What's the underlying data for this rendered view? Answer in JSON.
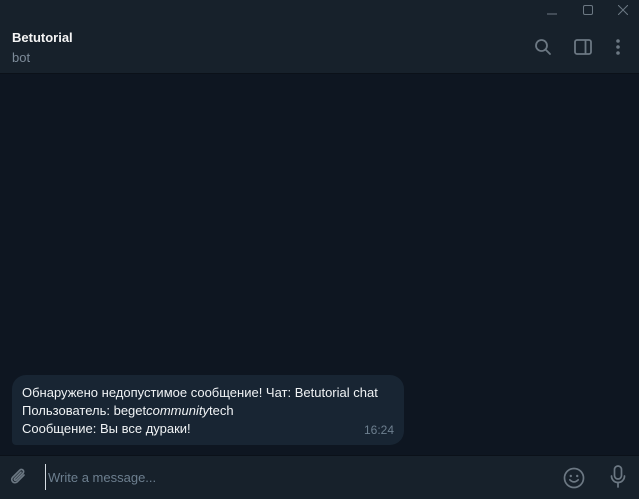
{
  "chat": {
    "title": "Betutorial",
    "subtitle": "bot"
  },
  "message": {
    "line1": "Обнаружено недопустимое сообщение! Чат: Betutorial chat",
    "line2_prefix": "Пользователь: beget",
    "line2_italic": "community",
    "line2_suffix": "tech",
    "line3": "Сообщение: Вы все дураки!",
    "time": "16:24"
  },
  "composer": {
    "placeholder": "Write a message..."
  },
  "icons": {
    "window": [
      "minimize-icon",
      "maximize-icon",
      "close-icon"
    ],
    "header": [
      "search-icon",
      "sidebar-panel-icon",
      "more-vertical-icon"
    ],
    "composer": [
      "paperclip-icon",
      "emoji-icon",
      "microphone-icon"
    ]
  },
  "colors": {
    "background": "#0e1621",
    "panel": "#17212b",
    "bubble": "#182533",
    "muted": "#6d7f8f",
    "icon": "#6c7883"
  }
}
